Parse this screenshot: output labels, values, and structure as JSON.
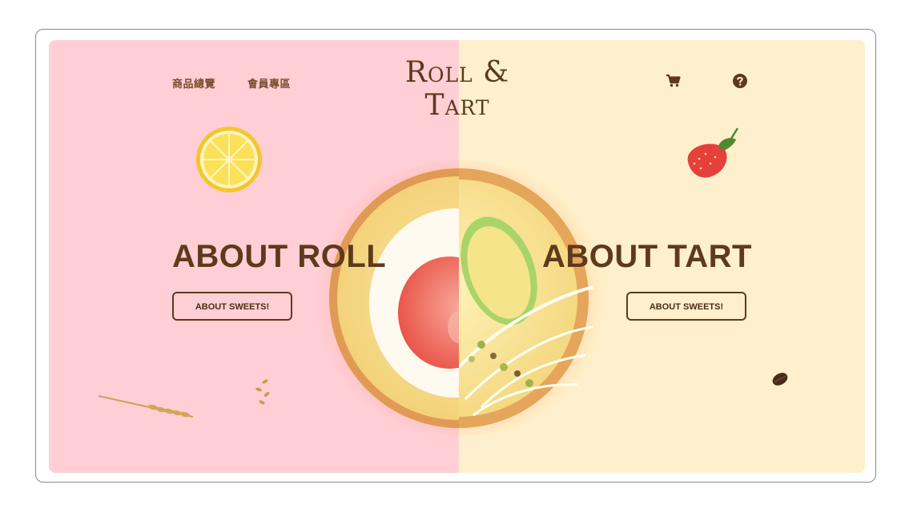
{
  "nav": {
    "products_label": "商品總覽",
    "members_label": "會員專區"
  },
  "logo": {
    "text": "Roll & Tart"
  },
  "icons": {
    "cart": "cart-icon",
    "help": "help-icon"
  },
  "roll": {
    "headline": "ABOUT ROLL",
    "button_label": "ABOUT SWEETS!"
  },
  "tart": {
    "headline": "ABOUT TART",
    "button_label": "ABOUT SWEETS!"
  },
  "colors": {
    "roll_bg": "#ffcfd5",
    "tart_bg": "#fff0cd",
    "brown": "#5e3a1c"
  }
}
